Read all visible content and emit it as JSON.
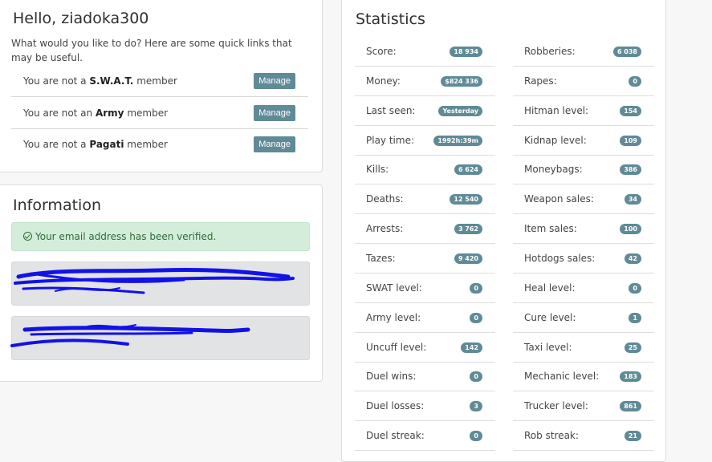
{
  "hello": {
    "title": "Hello, ziadoka300",
    "subtitle": "What would you like to do? Here are some quick links that may be useful.",
    "memberships": [
      {
        "prefix": "You are not a ",
        "group": "S.W.A.T.",
        "suffix": " member",
        "button": "Manage"
      },
      {
        "prefix": "You are not an ",
        "group": "Army",
        "suffix": " member",
        "button": "Manage"
      },
      {
        "prefix": "You are not a ",
        "group": "Pagati",
        "suffix": " member",
        "button": "Manage"
      }
    ]
  },
  "information": {
    "title": "Information",
    "alert": "Your email address has been verified."
  },
  "statistics": {
    "title": "Statistics",
    "left": [
      {
        "label": "Score:",
        "value": "18 934"
      },
      {
        "label": "Money:",
        "value": "$824 336"
      },
      {
        "label": "Last seen:",
        "value": "Yesterday"
      },
      {
        "label": "Play time:",
        "value": "1992h:39m"
      },
      {
        "label": "Kills:",
        "value": "6 624"
      },
      {
        "label": "Deaths:",
        "value": "12 540"
      },
      {
        "label": "Arrests:",
        "value": "3 762"
      },
      {
        "label": "Tazes:",
        "value": "9 420"
      },
      {
        "label": "SWAT level:",
        "value": "0"
      },
      {
        "label": "Army level:",
        "value": "0"
      },
      {
        "label": "Uncuff level:",
        "value": "142"
      },
      {
        "label": "Duel wins:",
        "value": "0"
      },
      {
        "label": "Duel losses:",
        "value": "3"
      },
      {
        "label": "Duel streak:",
        "value": "0"
      }
    ],
    "right": [
      {
        "label": "Robberies:",
        "value": "6 038"
      },
      {
        "label": "Rapes:",
        "value": "0"
      },
      {
        "label": "Hitman level:",
        "value": "154"
      },
      {
        "label": "Kidnap level:",
        "value": "109"
      },
      {
        "label": "Moneybags:",
        "value": "386"
      },
      {
        "label": "Weapon sales:",
        "value": "34"
      },
      {
        "label": "Item sales:",
        "value": "100"
      },
      {
        "label": "Hotdogs sales:",
        "value": "42"
      },
      {
        "label": "Heal level:",
        "value": "0"
      },
      {
        "label": "Cure level:",
        "value": "1"
      },
      {
        "label": "Taxi level:",
        "value": "25"
      },
      {
        "label": "Mechanic level:",
        "value": "183"
      },
      {
        "label": "Trucker level:",
        "value": "861"
      },
      {
        "label": "Rob streak:",
        "value": "21"
      }
    ]
  }
}
